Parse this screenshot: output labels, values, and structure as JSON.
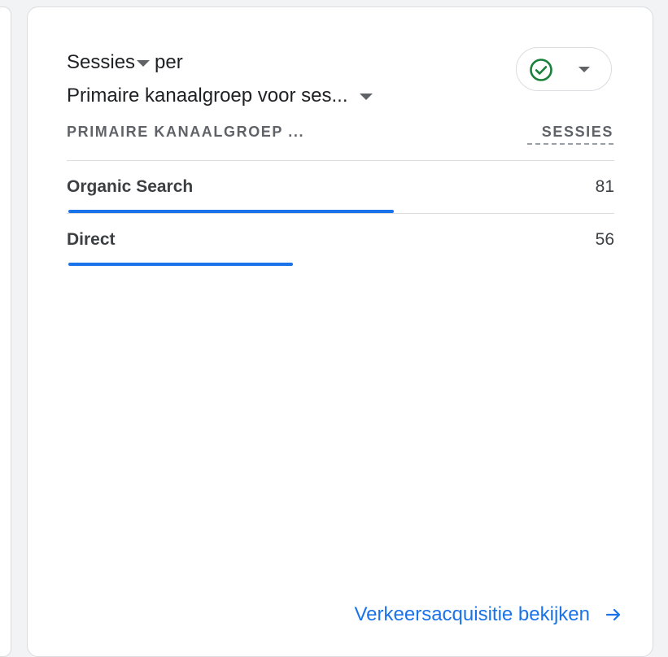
{
  "card": {
    "title": {
      "metric": "Sessies",
      "connector": "per",
      "dimension": "Primaire kanaalgroep voor ses..."
    },
    "status_chip": {
      "icon": "check-circle-icon",
      "icon_color": "#188038"
    },
    "table": {
      "dimension_header": "PRIMAIRE KANAALGROEP ...",
      "metric_header": "SESSIES",
      "rows": [
        {
          "label": "Organic Search",
          "value": "81",
          "bar_fraction": 1.0
        },
        {
          "label": "Direct",
          "value": "56",
          "bar_fraction": 0.691
        }
      ]
    },
    "footer_link": "Verkeersacquisitie bekijken"
  },
  "colors": {
    "accent": "#1a73e8",
    "text": "#202124",
    "muted": "#5f6368",
    "divider": "#dadce0"
  }
}
